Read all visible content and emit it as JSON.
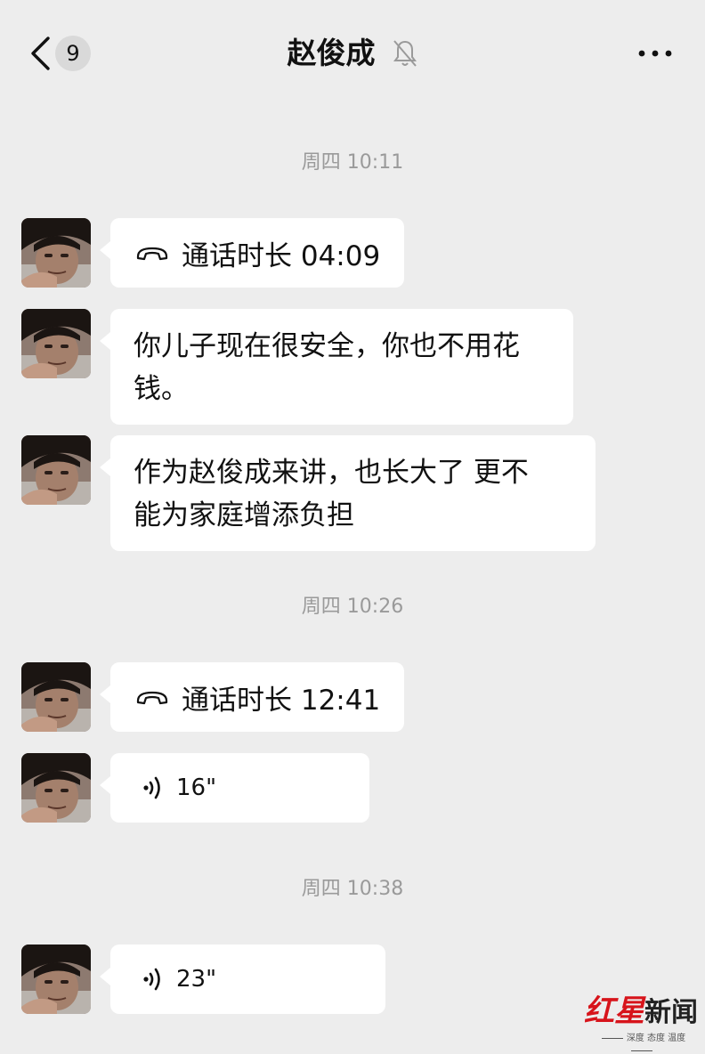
{
  "header": {
    "unread_count": "9",
    "title": "赵俊成",
    "back_icon": "chevron-left-icon",
    "mute_icon": "bell-off-icon",
    "more_icon": "ellipsis-icon"
  },
  "messages": [
    {
      "type": "timestamp",
      "text": "周四 10:11"
    },
    {
      "type": "call",
      "text": "通话时长 04:09"
    },
    {
      "type": "text",
      "line1": "你儿子现在很安全，你也不用花",
      "line2": "钱。"
    },
    {
      "type": "text",
      "line1": "作为赵俊成来讲，也长大了 更不",
      "line2": "能为家庭增添负担"
    },
    {
      "type": "timestamp",
      "text": "周四 10:26"
    },
    {
      "type": "call",
      "text": "通话时长 12:41"
    },
    {
      "type": "voice",
      "text": "16\""
    },
    {
      "type": "timestamp",
      "text": "周四 10:38"
    },
    {
      "type": "voice",
      "text": "23\""
    }
  ],
  "watermark": {
    "red_text": "红星",
    "dark_text": "新闻",
    "tagline": "深度 态度 温度"
  },
  "colors": {
    "background": "#ededed",
    "bubble": "#ffffff",
    "timestamp_text": "#9a9a9a",
    "watermark_red": "#d7141b"
  }
}
